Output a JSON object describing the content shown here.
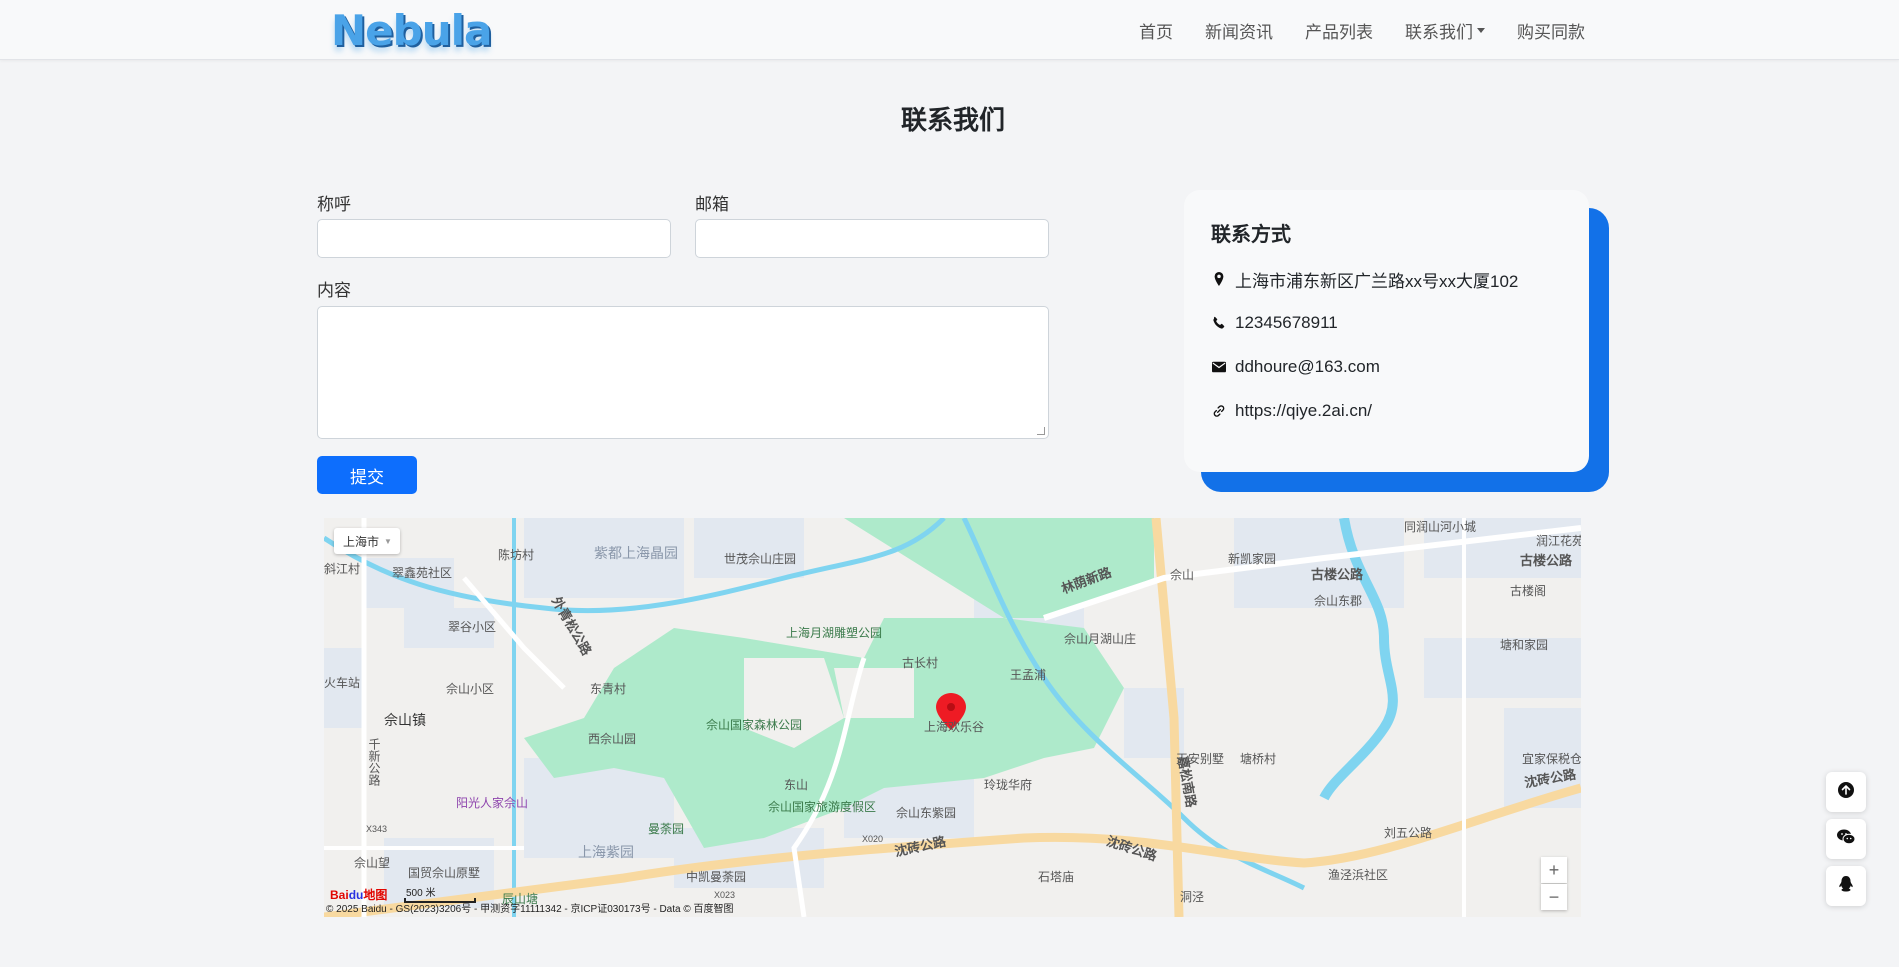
{
  "brand": {
    "logo_text": "Nebula"
  },
  "nav": {
    "home": "首页",
    "news": "新闻资讯",
    "products": "产品列表",
    "contact": "联系我们",
    "buy": "购买同款"
  },
  "page": {
    "title": "联系我们"
  },
  "form": {
    "name_label": "称呼",
    "name_value": "",
    "email_label": "邮箱",
    "email_value": "",
    "content_label": "内容",
    "content_value": "",
    "submit_label": "提交"
  },
  "contact_card": {
    "title": "联系方式",
    "address": "上海市浦东新区广兰路xx号xx大厦102",
    "phone": "12345678911",
    "email": "ddhoure@163.com",
    "website": "https://qiye.2ai.cn/"
  },
  "map": {
    "city_selector": "上海市",
    "zoom_in": "+",
    "zoom_out": "−",
    "scale_label": "500 米",
    "copyright": "© 2025 Baidu - GS(2023)3206号 - 甲测资字11111342 - 京ICP证030173号 - Data © 百度智图",
    "labels": {
      "huanlegu": "上海欢乐谷",
      "sheshan_town": "佘山镇",
      "zidu_jingyuan": "紫都上海晶园",
      "shimao": "世茂佘山庄园",
      "yuehu": "上海月湖雕塑公园",
      "gubao": "古长村",
      "wangmengpu": "王孟浦",
      "senlin": "佘山国家森林公园",
      "xiyuan": "西佘山园",
      "dongshan": "东山",
      "dujiaqu": "佘山国家旅游度假区",
      "zhongkai": "中凯曼荼园",
      "mantuoyuan": "曼荼园",
      "zijing": "上海紫园",
      "linglong": "玲珑华府",
      "dongziyuan": "佘山东紫园",
      "yueshu": "佘山月湖山庄",
      "xinkai": "新凯家园",
      "sheshan_dong": "佘山东郡",
      "sheshan_station": "佘山",
      "gulou": "古楼公路",
      "linyin": "林荫新路",
      "jiasong": "嘉松南路",
      "tiananbieshu": "天安别墅",
      "tangqiao": "塘桥村",
      "shenzhuan": "沈砖公路",
      "shenzhuan2": "沈砖公路",
      "shenzhuan3": "沈砖公路",
      "liuwu": "刘五公路",
      "yugang": "渔泾浜社区",
      "dongjing": "洞泾",
      "shitamiao": "石塔庙",
      "tanghejia": "塘和家园",
      "yijia": "宜家保税仓",
      "gulouge": "古楼阁",
      "runjiang": "润江花苑",
      "gulou2": "古楼公路",
      "tongrun": "同润山河小城",
      "chenfang": "陈坊村",
      "cuixin": "翠鑫苑社区",
      "cuigu": "翠谷小区",
      "sheshan_xiaoqu": "佘山小区",
      "dongqing": "东青村",
      "waiqing": "外青松公路",
      "yangguang": "阳光人家佘山",
      "qianxin": "千新公路",
      "guomao": "国贸佘山原墅",
      "sheshanwang": "佘山望",
      "chenshantang": "辰山塘",
      "huochezhan": "火车站",
      "xiangjiang": "斜江村",
      "x343": "X343",
      "x020": "X020",
      "x023": "X023"
    }
  }
}
